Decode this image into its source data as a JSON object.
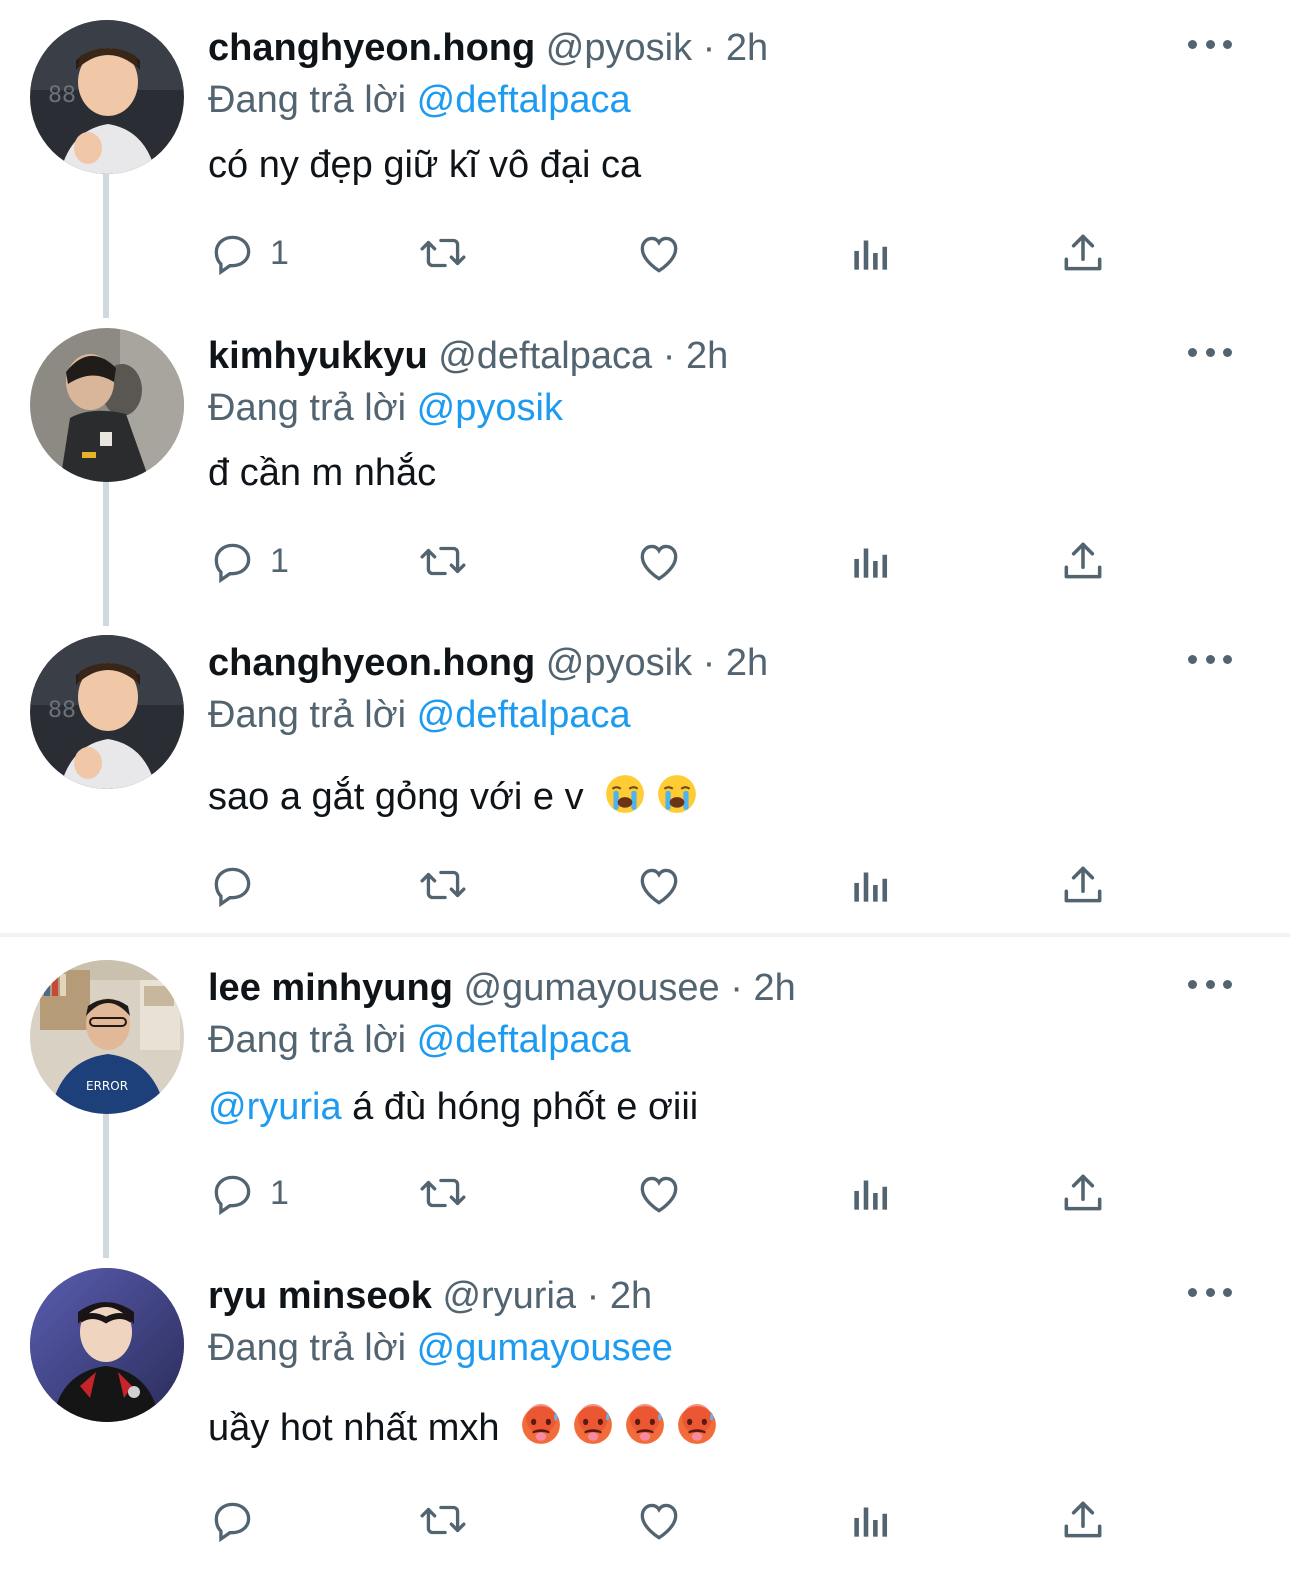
{
  "reply_prefix": "Đang trả lời",
  "tweets": [
    {
      "name": "changhyeon.hong",
      "handle": "@pyosik",
      "time": "2h",
      "replying_to": "@deftalpaca",
      "text": "có ny đẹp giữ kĩ vô đại ca",
      "reply_count": "1"
    },
    {
      "name": "kimhyukkyu",
      "handle": "@deftalpaca",
      "time": "2h",
      "replying_to": "@pyosik",
      "text": "đ cần m nhắc",
      "reply_count": "1"
    },
    {
      "name": "changhyeon.hong",
      "handle": "@pyosik",
      "time": "2h",
      "replying_to": "@deftalpaca",
      "text": "sao a gắt gỏng với e v",
      "reply_count": "",
      "emojis": [
        "loudly-crying-face-emoji",
        "loudly-crying-face-emoji"
      ]
    },
    {
      "name": "lee minhyung",
      "handle": "@gumayousee",
      "time": "2h",
      "replying_to": "@deftalpaca",
      "text_mention": "@ryuria",
      "text": "á đù hóng phốt e ơiii",
      "reply_count": "1"
    },
    {
      "name": "ryu minseok",
      "handle": "@ryuria",
      "time": "2h",
      "replying_to": "@gumayousee",
      "text": "uầy hot nhất mxh",
      "reply_count": "",
      "emojis": [
        "hot-face-emoji",
        "hot-face-emoji",
        "hot-face-emoji",
        "hot-face-emoji"
      ]
    }
  ],
  "colors": {
    "link": "#1d9bf0",
    "muted": "#536471",
    "text": "#0f1419",
    "thread_line": "#cfd9de"
  }
}
